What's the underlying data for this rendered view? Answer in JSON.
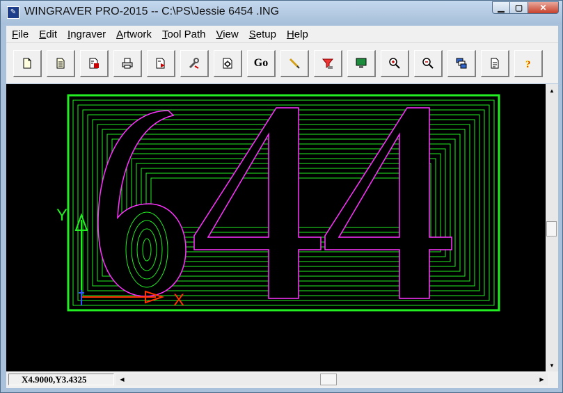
{
  "window": {
    "title": "WINGRAVER PRO-2015 -- C:\\PS\\Jessie 6454 .ING",
    "icon": "wingraver-app-icon",
    "controls": {
      "minimize": "minimize-icon",
      "maximize": "maximize-icon",
      "close": "close-icon"
    }
  },
  "menu": {
    "items": [
      {
        "label_ul": "F",
        "label_rest": "ile"
      },
      {
        "label_ul": "E",
        "label_rest": "dit"
      },
      {
        "label_ul": "I",
        "label_rest": "ngraver"
      },
      {
        "label_ul": "A",
        "label_rest": "rtwork"
      },
      {
        "label_ul": "T",
        "label_rest": "ool Path"
      },
      {
        "label_ul": "V",
        "label_rest": "iew"
      },
      {
        "label_ul": "S",
        "label_rest": "etup"
      },
      {
        "label_ul": "H",
        "label_rest": "elp"
      }
    ]
  },
  "toolbar": {
    "go_label": "Go",
    "buttons": [
      "new-file-icon",
      "open-file-icon",
      "save-file-icon",
      "print-icon",
      "export-icon",
      "tools-icon",
      "settings-icon",
      "go-button",
      "pencil-icon",
      "engrave-icon",
      "display-icon",
      "zoom-in-icon",
      "zoom-out-icon",
      "layers-icon",
      "page-icon",
      "help-icon"
    ]
  },
  "canvas": {
    "artwork_text": "644",
    "axis_y_label": "Y",
    "axis_x_label": "X",
    "colors": {
      "background": "#000000",
      "toolpath": "#22ee22",
      "border": "#22ee22",
      "outline": "#ff33ff",
      "y_axis": "#22ee22",
      "x_axis": "#ff3300",
      "origin": "#3355ff"
    }
  },
  "status": {
    "coordinates": "X4.9000,Y3.4325"
  }
}
